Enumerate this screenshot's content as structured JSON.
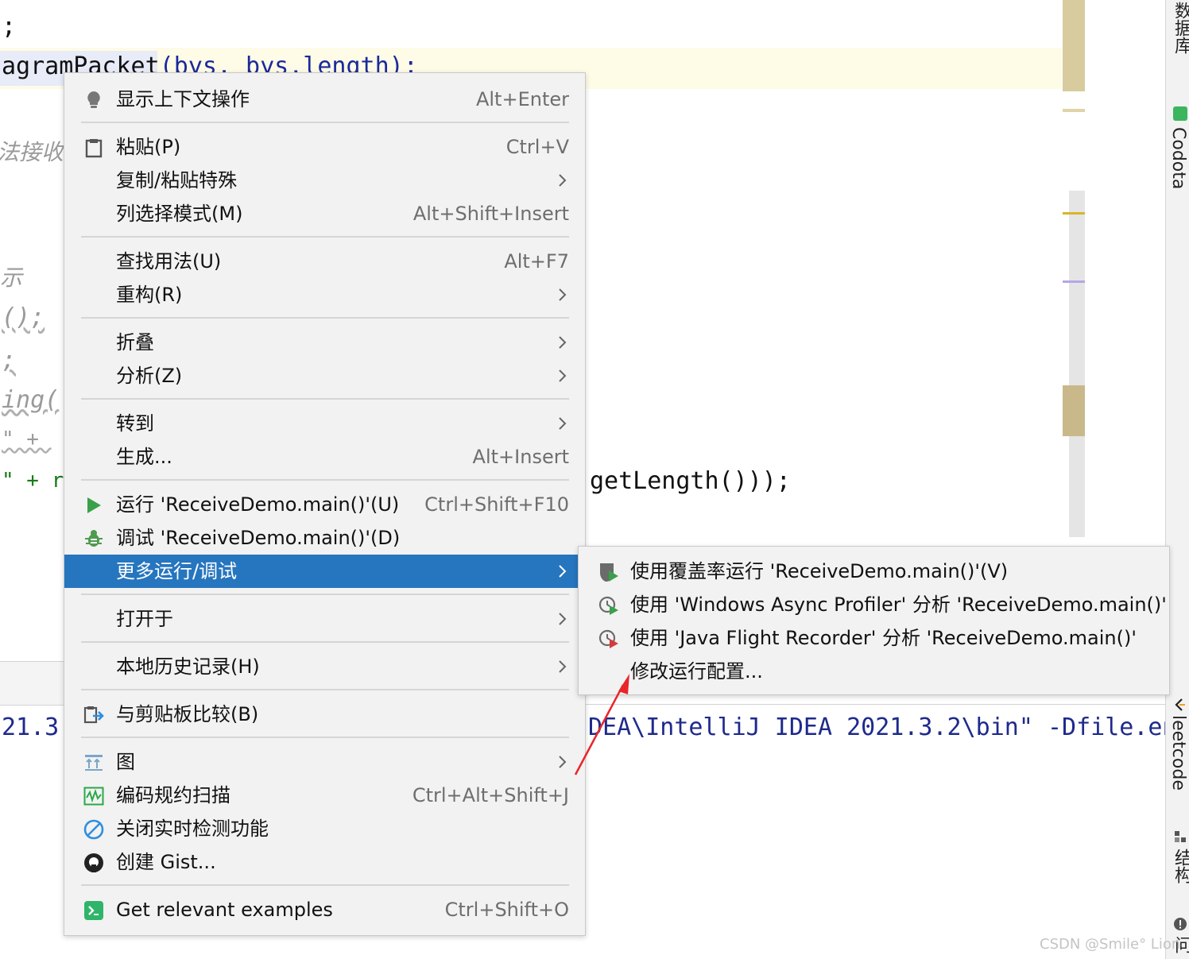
{
  "editor": {
    "line1": ";",
    "line2_sel": "agramPacket",
    "line2_rest": "(bys, bys.length);",
    "comment1": "法接收",
    "comment2": "示",
    "code3": "();",
    "code4": ";",
    "code5": "ing(",
    "code6": "\" + ",
    "code7_left": "\" + r",
    "code7_right": "getLength()));"
  },
  "console": {
    "left_text": "21.3",
    "right_text": "DEA\\IntelliJ IDEA 2021.3.2\\bin\" -Dfile.en"
  },
  "sidebar": {
    "database_label": "数据库",
    "codota_label": "Codota",
    "leetcode_label": "leetcode",
    "structure_label": "结构",
    "extra_label": "问"
  },
  "context_menu": {
    "items": [
      {
        "label": "显示上下文操作",
        "shortcut": "Alt+Enter",
        "icon": "lightbulb-icon"
      },
      {
        "label": "粘贴(P)",
        "shortcut": "Ctrl+V",
        "icon": "clipboard-icon"
      },
      {
        "label": "复制/粘贴特殊",
        "shortcut": ""
      },
      {
        "label": "列选择模式(M)",
        "shortcut": "Alt+Shift+Insert"
      },
      {
        "label": "查找用法(U)",
        "shortcut": "Alt+F7"
      },
      {
        "label": "重构(R)",
        "shortcut": ""
      },
      {
        "label": "折叠",
        "shortcut": ""
      },
      {
        "label": "分析(Z)",
        "shortcut": ""
      },
      {
        "label": "转到",
        "shortcut": ""
      },
      {
        "label": "生成...",
        "shortcut": "Alt+Insert"
      },
      {
        "label": "运行 'ReceiveDemo.main()'(U)",
        "shortcut": "Ctrl+Shift+F10",
        "icon": "run-icon"
      },
      {
        "label": "调试 'ReceiveDemo.main()'(D)",
        "shortcut": "",
        "icon": "debug-icon"
      },
      {
        "label": "更多运行/调试",
        "shortcut": ""
      },
      {
        "label": "打开于",
        "shortcut": ""
      },
      {
        "label": "本地历史记录(H)",
        "shortcut": ""
      },
      {
        "label": "与剪贴板比较(B)",
        "shortcut": "",
        "icon": "compare-clipboard-icon"
      },
      {
        "label": "图",
        "shortcut": "",
        "icon": "diagram-icon"
      },
      {
        "label": "编码规约扫描",
        "shortcut": "Ctrl+Alt+Shift+J",
        "icon": "scan-icon"
      },
      {
        "label": "关闭实时检测功能",
        "shortcut": "",
        "icon": "disable-icon"
      },
      {
        "label": "创建 Gist...",
        "shortcut": "",
        "icon": "github-icon"
      },
      {
        "label": "Get relevant examples",
        "shortcut": "Ctrl+Shift+O",
        "icon": "codota-icon"
      }
    ]
  },
  "submenu": {
    "items": [
      {
        "label": "使用覆盖率运行  'ReceiveDemo.main()'(V)",
        "icon": "coverage-icon"
      },
      {
        "label": "使用 'Windows Async Profiler' 分析  'ReceiveDemo.main()'",
        "icon": "profiler-icon"
      },
      {
        "label": "使用 'Java Flight Recorder' 分析  'ReceiveDemo.main()'",
        "icon": "flight-recorder-icon"
      },
      {
        "label": "修改运行配置...",
        "icon": ""
      }
    ]
  },
  "watermark": "CSDN @Smile° Lion",
  "colors": {
    "menu_bg": "#f2f2f2",
    "selected_bg": "#2675bf",
    "run_green": "#3aa04a",
    "arrow_red": "#e8262a"
  }
}
